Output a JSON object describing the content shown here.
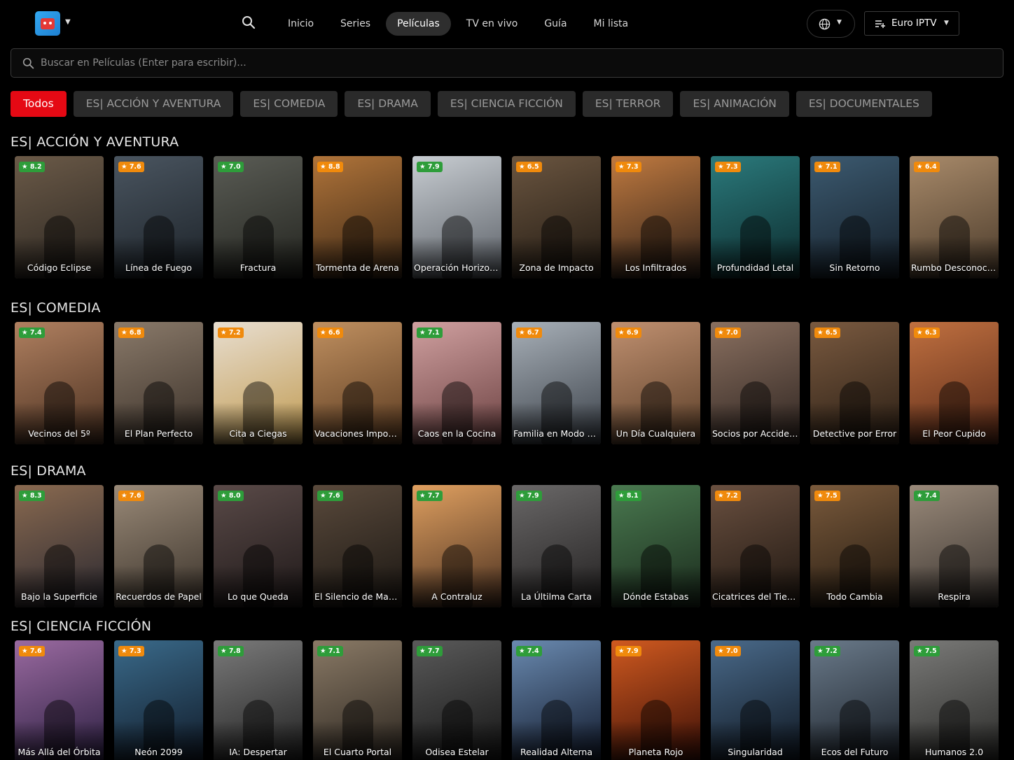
{
  "header": {
    "nav": [
      {
        "label": "Inicio",
        "active": false
      },
      {
        "label": "Series",
        "active": false
      },
      {
        "label": "Películas",
        "active": true
      },
      {
        "label": "TV en vivo",
        "active": false
      },
      {
        "label": "Guía",
        "active": false
      },
      {
        "label": "Mi lista",
        "active": false
      }
    ],
    "source_label": "Euro IPTV"
  },
  "search": {
    "placeholder": "Buscar en Películas (Enter para escribir)..."
  },
  "categories": [
    {
      "label": "Todos",
      "active": true
    },
    {
      "label": "ES| ACCIÓN Y AVENTURA",
      "active": false
    },
    {
      "label": "ES| COMEDIA",
      "active": false
    },
    {
      "label": "ES| DRAMA",
      "active": false
    },
    {
      "label": "ES| CIENCIA FICCIÓN",
      "active": false
    },
    {
      "label": "ES| TERROR",
      "active": false
    },
    {
      "label": "ES| ANIMACIÓN",
      "active": false
    },
    {
      "label": "ES| DOCUMENTALES",
      "active": false
    }
  ],
  "colors": {
    "accent": "#e50914",
    "rating_green": "#2e9d3a",
    "rating_orange": "#f08a0c"
  },
  "sections": [
    {
      "title": "ES| ACCIÓN Y AVENTURA",
      "movies": [
        {
          "title": "Código Eclipse",
          "rating": "★ 8.2",
          "badge": "green",
          "tone": [
            "#6b5a48",
            "#2a2520"
          ]
        },
        {
          "title": "Línea de Fuego",
          "rating": "★ 7.6",
          "badge": "orange",
          "tone": [
            "#4a5560",
            "#1c2228"
          ]
        },
        {
          "title": "Fractura",
          "rating": "★ 7.0",
          "badge": "green",
          "tone": [
            "#5a5c55",
            "#23241f"
          ]
        },
        {
          "title": "Tormenta de Arena",
          "rating": "★ 8.8",
          "badge": "orange",
          "tone": [
            "#b0743a",
            "#3a2614"
          ]
        },
        {
          "title": "Operación Horizonte",
          "rating": "★ 7.9",
          "badge": "green",
          "tone": [
            "#c8cdd2",
            "#5a5f66"
          ]
        },
        {
          "title": "Zona de Impacto",
          "rating": "★ 6.5",
          "badge": "orange",
          "tone": [
            "#6a5540",
            "#221a12"
          ]
        },
        {
          "title": "Los Infiltrados",
          "rating": "★ 7.3",
          "badge": "orange",
          "tone": [
            "#c07a40",
            "#2e2018"
          ]
        },
        {
          "title": "Profundidad Letal",
          "rating": "★ 7.3",
          "badge": "orange",
          "tone": [
            "#2b7a7c",
            "#0c2a2c"
          ]
        },
        {
          "title": "Sin Retorno",
          "rating": "★ 7.1",
          "badge": "orange",
          "tone": [
            "#3c5a70",
            "#141e28"
          ]
        },
        {
          "title": "Rumbo Desconocido",
          "rating": "★ 6.4",
          "badge": "orange",
          "tone": [
            "#a88a6a",
            "#4a3a2a"
          ]
        }
      ]
    },
    {
      "title": "ES| COMEDIA",
      "movies": [
        {
          "title": "Vecinos del 5º",
          "rating": "★ 7.4",
          "badge": "green",
          "tone": [
            "#b08060",
            "#4a3020"
          ]
        },
        {
          "title": "El Plan Perfecto",
          "rating": "★ 6.8",
          "badge": "orange",
          "tone": [
            "#8a7a6a",
            "#3a3028"
          ]
        },
        {
          "title": "Cita a Ciegas",
          "rating": "★ 7.2",
          "badge": "orange",
          "tone": [
            "#e8ded0",
            "#c09a50"
          ]
        },
        {
          "title": "Vacaciones Imposibles",
          "rating": "★ 6.6",
          "badge": "orange",
          "tone": [
            "#c09060",
            "#5a3a20"
          ]
        },
        {
          "title": "Caos en la Cocina",
          "rating": "★ 7.1",
          "badge": "green",
          "tone": [
            "#d0a0a0",
            "#6a4040"
          ]
        },
        {
          "title": "Familia en Modo Avión",
          "rating": "★ 6.7",
          "badge": "orange",
          "tone": [
            "#a8b0b8",
            "#3a4048"
          ]
        },
        {
          "title": "Un Día Cualquiera",
          "rating": "★ 6.9",
          "badge": "orange",
          "tone": [
            "#c09070",
            "#5a3e28"
          ]
        },
        {
          "title": "Socios por Accidente",
          "rating": "★ 7.0",
          "badge": "orange",
          "tone": [
            "#8a7060",
            "#2e2420"
          ]
        },
        {
          "title": "Detective por Error",
          "rating": "★ 6.5",
          "badge": "orange",
          "tone": [
            "#7a5a40",
            "#2a1e14"
          ]
        },
        {
          "title": "El Peor Cupido",
          "rating": "★ 6.3",
          "badge": "orange",
          "tone": [
            "#c07040",
            "#5a2a18"
          ]
        }
      ]
    },
    {
      "title": "ES| DRAMA",
      "movies": [
        {
          "title": "Bajo la Superficie",
          "rating": "★ 8.3",
          "badge": "green",
          "tone": [
            "#8a6a50",
            "#2a2830"
          ]
        },
        {
          "title": "Recuerdos de Papel",
          "rating": "★ 7.6",
          "badge": "orange",
          "tone": [
            "#9a8a78",
            "#3a322a"
          ]
        },
        {
          "title": "Lo que Queda",
          "rating": "★ 8.0",
          "badge": "green",
          "tone": [
            "#5a4a48",
            "#1e1818"
          ]
        },
        {
          "title": "El Silencio de Marcos",
          "rating": "★ 7.6",
          "badge": "green",
          "tone": [
            "#5a4a3c",
            "#1a1612"
          ]
        },
        {
          "title": "A Contraluz",
          "rating": "★ 7.7",
          "badge": "green",
          "tone": [
            "#e0a060",
            "#4a3020"
          ]
        },
        {
          "title": "La Últilma Carta",
          "rating": "★ 7.9",
          "badge": "green",
          "tone": [
            "#6a6868",
            "#222020"
          ]
        },
        {
          "title": "Dónde Estabas",
          "rating": "★ 8.1",
          "badge": "green",
          "tone": [
            "#4a7a50",
            "#1a2a1c"
          ]
        },
        {
          "title": "Cicatrices del Tiempo",
          "rating": "★ 7.2",
          "badge": "orange",
          "tone": [
            "#6a5040",
            "#1e1610"
          ]
        },
        {
          "title": "Todo Cambia",
          "rating": "★ 7.5",
          "badge": "orange",
          "tone": [
            "#7a5a3c",
            "#241a10"
          ]
        },
        {
          "title": "Respira",
          "rating": "★ 7.4",
          "badge": "green",
          "tone": [
            "#9a8a7a",
            "#3a3430"
          ]
        }
      ]
    },
    {
      "title": "ES| CIENCIA FICCIÓN",
      "movies": [
        {
          "title": "Más Allá del Órbita",
          "rating": "★ 7.6",
          "badge": "orange",
          "tone": [
            "#9a6aa0",
            "#2a1e40"
          ]
        },
        {
          "title": "Neón 2099",
          "rating": "★ 7.3",
          "badge": "orange",
          "tone": [
            "#3a6a8a",
            "#101a28"
          ]
        },
        {
          "title": "IA: Despertar",
          "rating": "★ 7.8",
          "badge": "green",
          "tone": [
            "#7a7a7a",
            "#202020"
          ]
        },
        {
          "title": "El Cuarto Portal",
          "rating": "★ 7.1",
          "badge": "green",
          "tone": [
            "#8a7a66",
            "#2a241e"
          ]
        },
        {
          "title": "Odisea Estelar",
          "rating": "★ 7.7",
          "badge": "green",
          "tone": [
            "#5a5a5a",
            "#141414"
          ]
        },
        {
          "title": "Realidad Alterna",
          "rating": "★ 7.4",
          "badge": "green",
          "tone": [
            "#6a8ab0",
            "#10182a"
          ]
        },
        {
          "title": "Planeta Rojo",
          "rating": "★ 7.9",
          "badge": "orange",
          "tone": [
            "#d05a20",
            "#3a0e06"
          ]
        },
        {
          "title": "Singularidad",
          "rating": "★ 7.0",
          "badge": "orange",
          "tone": [
            "#4a6a8a",
            "#0e1620"
          ]
        },
        {
          "title": "Ecos del Futuro",
          "rating": "★ 7.2",
          "badge": "green",
          "tone": [
            "#6a7a8a",
            "#1a2028"
          ]
        },
        {
          "title": "Humanos 2.0",
          "rating": "★ 7.5",
          "badge": "green",
          "tone": [
            "#7a7a78",
            "#2a2a28"
          ]
        }
      ]
    }
  ]
}
